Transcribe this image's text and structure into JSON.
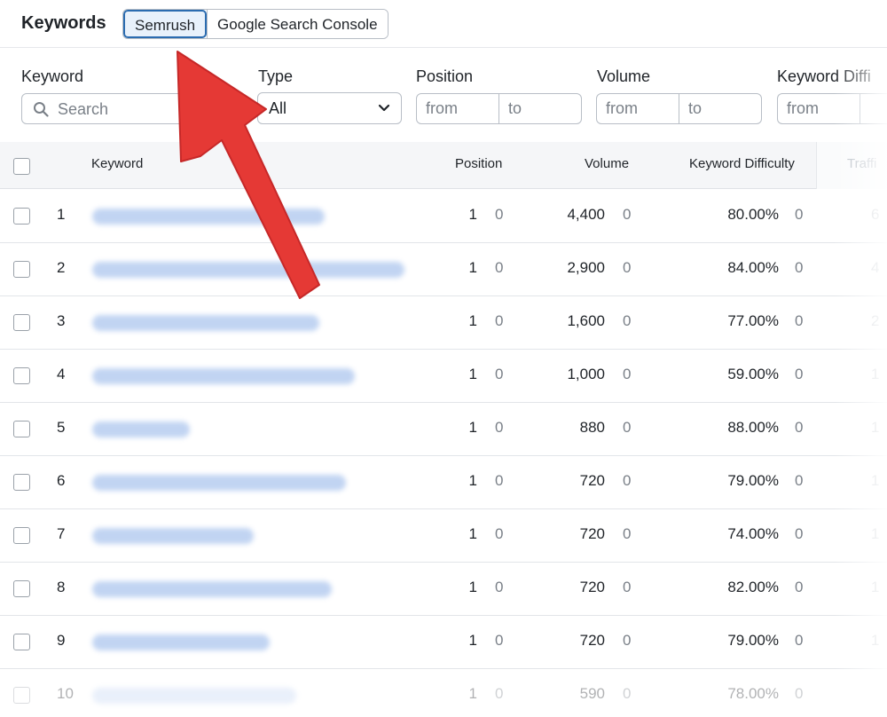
{
  "header": {
    "title": "Keywords",
    "tabs": [
      {
        "label": "Semrush",
        "active": true
      },
      {
        "label": "Google Search Console",
        "active": false
      }
    ]
  },
  "filters": {
    "keyword": {
      "label": "Keyword",
      "placeholder": "Search"
    },
    "type": {
      "label": "Type",
      "value": "All"
    },
    "position": {
      "label": "Position",
      "from_placeholder": "from",
      "to_placeholder": "to"
    },
    "volume": {
      "label": "Volume",
      "from_placeholder": "from",
      "to_placeholder": "to"
    },
    "difficulty": {
      "label": "Keyword Diffi",
      "from_placeholder": "from"
    }
  },
  "table": {
    "columns": [
      "Keyword",
      "Position",
      "Volume",
      "Keyword Difficulty",
      "Traffi"
    ],
    "rows": [
      {
        "idx": "1",
        "kw_width": 262,
        "position": "1",
        "position_delta": "0",
        "volume": "4,400",
        "volume_delta": "0",
        "kd": "80.00%",
        "kd_delta": "0",
        "traffic": "6"
      },
      {
        "idx": "2",
        "kw_width": 352,
        "position": "1",
        "position_delta": "0",
        "volume": "2,900",
        "volume_delta": "0",
        "kd": "84.00%",
        "kd_delta": "0",
        "traffic": "4"
      },
      {
        "idx": "3",
        "kw_width": 256,
        "position": "1",
        "position_delta": "0",
        "volume": "1,600",
        "volume_delta": "0",
        "kd": "77.00%",
        "kd_delta": "0",
        "traffic": "2"
      },
      {
        "idx": "4",
        "kw_width": 296,
        "position": "1",
        "position_delta": "0",
        "volume": "1,000",
        "volume_delta": "0",
        "kd": "59.00%",
        "kd_delta": "0",
        "traffic": "1"
      },
      {
        "idx": "5",
        "kw_width": 110,
        "position": "1",
        "position_delta": "0",
        "volume": "880",
        "volume_delta": "0",
        "kd": "88.00%",
        "kd_delta": "0",
        "traffic": "1"
      },
      {
        "idx": "6",
        "kw_width": 286,
        "position": "1",
        "position_delta": "0",
        "volume": "720",
        "volume_delta": "0",
        "kd": "79.00%",
        "kd_delta": "0",
        "traffic": "1"
      },
      {
        "idx": "7",
        "kw_width": 182,
        "position": "1",
        "position_delta": "0",
        "volume": "720",
        "volume_delta": "0",
        "kd": "74.00%",
        "kd_delta": "0",
        "traffic": "1"
      },
      {
        "idx": "8",
        "kw_width": 270,
        "position": "1",
        "position_delta": "0",
        "volume": "720",
        "volume_delta": "0",
        "kd": "82.00%",
        "kd_delta": "0",
        "traffic": "1"
      },
      {
        "idx": "9",
        "kw_width": 200,
        "position": "1",
        "position_delta": "0",
        "volume": "720",
        "volume_delta": "0",
        "kd": "79.00%",
        "kd_delta": "0",
        "traffic": "1"
      },
      {
        "idx": "10",
        "kw_width": 230,
        "position": "1",
        "position_delta": "0",
        "volume": "590",
        "volume_delta": "0",
        "kd": "78.00%",
        "kd_delta": "0",
        "traffic": ""
      }
    ]
  },
  "colors": {
    "accent": "#2b6cb0",
    "annotation_arrow": "#e53935"
  }
}
